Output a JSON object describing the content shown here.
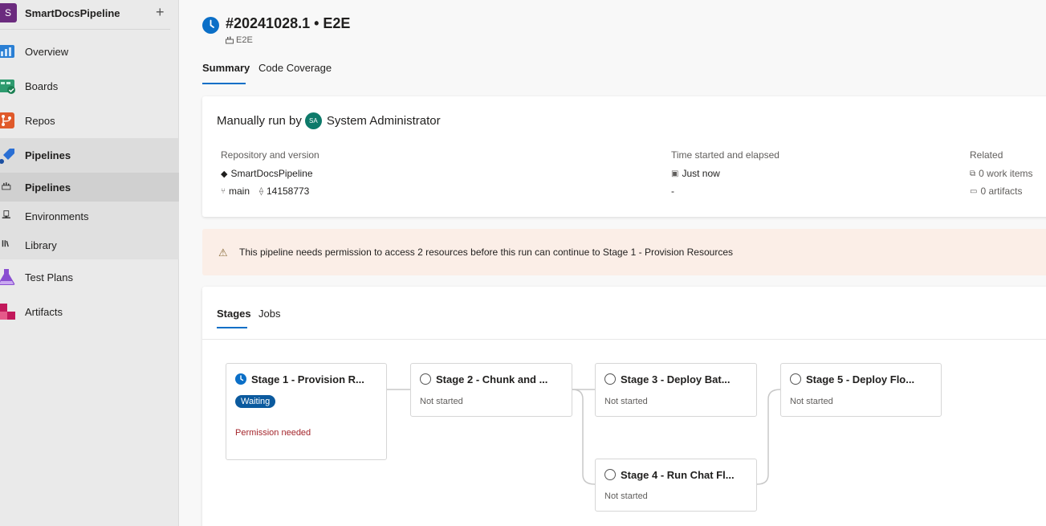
{
  "project": {
    "badge": "S",
    "name": "SmartDocsPipeline",
    "add": "+"
  },
  "nav": [
    {
      "label": "Overview",
      "icon": "overview-icon"
    },
    {
      "label": "Boards",
      "icon": "boards-icon"
    },
    {
      "label": "Repos",
      "icon": "repos-icon"
    },
    {
      "label": "Pipelines",
      "icon": "pipelines-icon"
    },
    {
      "label": "Pipelines",
      "icon": "pipelines-sub-icon"
    },
    {
      "label": "Environments",
      "icon": "environments-icon"
    },
    {
      "label": "Library",
      "icon": "library-icon"
    },
    {
      "label": "Test Plans",
      "icon": "test-plans-icon"
    },
    {
      "label": "Artifacts",
      "icon": "artifacts-icon"
    }
  ],
  "run": {
    "title": "#20241028.1 • E2E",
    "pipeline": "E2E",
    "tabs": [
      "Summary",
      "Code Coverage"
    ],
    "manually_run_by": "Manually run by",
    "avatar_initials": "SA",
    "user": "System Administrator",
    "repo_label": "Repository and version",
    "repo_name": "SmartDocsPipeline",
    "branch": "main",
    "commit": "14158773",
    "time_label": "Time started and elapsed",
    "started": "Just now",
    "elapsed": "-",
    "related_label": "Related",
    "work_items": "0 work items",
    "artifacts": "0 artifacts"
  },
  "warning": {
    "text": "This pipeline needs permission to access 2 resources before this run can continue to Stage 1 - Provision Resources"
  },
  "stages_tabs": [
    "Stages",
    "Jobs"
  ],
  "stages": [
    {
      "title": "Stage 1 - Provision R...",
      "status": "Waiting",
      "note": "Permission needed"
    },
    {
      "title": "Stage 2 - Chunk and ...",
      "status": "Not started"
    },
    {
      "title": "Stage 3 - Deploy Bat...",
      "status": "Not started"
    },
    {
      "title": "Stage 5 - Deploy Flo...",
      "status": "Not started"
    },
    {
      "title": "Stage 4 - Run Chat Fl...",
      "status": "Not started"
    }
  ],
  "colors": {
    "accent": "#0b6fc7",
    "warning_bg": "#fbeee7",
    "error": "#a4262c"
  }
}
